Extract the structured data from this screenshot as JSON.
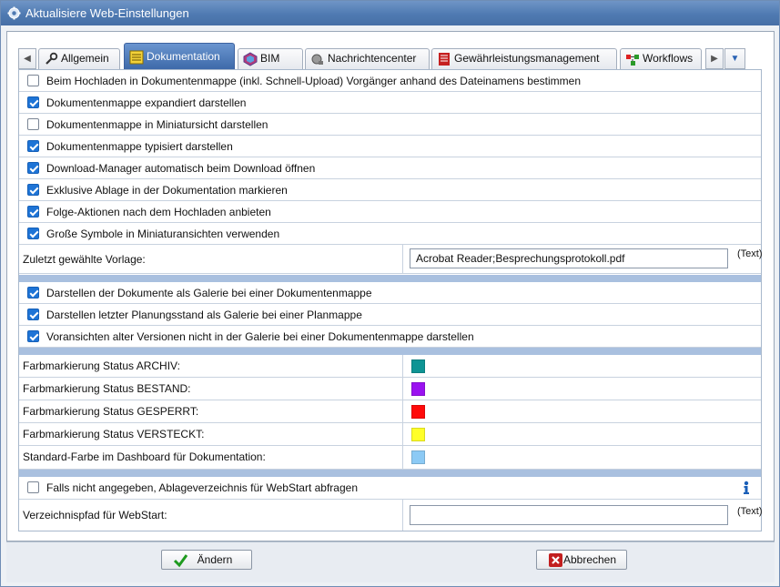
{
  "window": {
    "title": "Aktualisiere Web-Einstellungen"
  },
  "tabs": [
    {
      "label": "Allgemein",
      "icon": "wrench-icon"
    },
    {
      "label": "Dokumentation",
      "icon": "document-list-icon",
      "active": true
    },
    {
      "label": "BIM",
      "icon": "bim-icon"
    },
    {
      "label": "Nachrichtencenter",
      "icon": "satellite-icon"
    },
    {
      "label": "Gewährleistungsmanagement",
      "icon": "warranty-icon"
    },
    {
      "label": "Workflows",
      "icon": "workflow-icon"
    }
  ],
  "checkboxes_1": [
    {
      "label": "Beim Hochladen in Dokumentenmappe (inkl. Schnell-Upload) Vorgänger anhand des Dateinamens bestimmen",
      "checked": false
    },
    {
      "label": "Dokumentenmappe expandiert darstellen",
      "checked": true
    },
    {
      "label": "Dokumentenmappe in Miniatursicht darstellen",
      "checked": false
    },
    {
      "label": "Dokumentenmappe typisiert darstellen",
      "checked": true
    },
    {
      "label": "Download-Manager automatisch beim Download öffnen",
      "checked": true
    },
    {
      "label": "Exklusive Ablage in der Dokumentation markieren",
      "checked": true
    },
    {
      "label": "Folge-Aktionen nach dem Hochladen anbieten",
      "checked": true
    },
    {
      "label": "Große Symbole in Miniaturansichten verwenden",
      "checked": true
    }
  ],
  "vorlage": {
    "label": "Zuletzt gewählte Vorlage:",
    "value": "Acrobat Reader;Besprechungsprotokoll.pdf",
    "type_label": "(Text)"
  },
  "checkboxes_2": [
    {
      "label": "Darstellen der Dokumente als Galerie bei einer Dokumentenmappe",
      "checked": true
    },
    {
      "label": "Darstellen letzter Planungsstand als Galerie bei einer Planmappe",
      "checked": true
    },
    {
      "label": "Voransichten alter Versionen nicht in der Galerie bei einer Dokumentenmappe darstellen",
      "checked": true
    }
  ],
  "colors": [
    {
      "label": "Farbmarkierung Status ARCHIV:",
      "color": "#0e9494"
    },
    {
      "label": "Farbmarkierung Status BESTAND:",
      "color": "#9a12f0"
    },
    {
      "label": "Farbmarkierung Status GESPERRT:",
      "color": "#ff0a0a"
    },
    {
      "label": "Farbmarkierung Status VERSTECKT:",
      "color": "#ffff29"
    },
    {
      "label": "Standard-Farbe im Dashboard für Dokumentation:",
      "color": "#8ccaf5"
    }
  ],
  "webstart": {
    "checkbox_label": "Falls nicht angegeben, Ablageverzeichnis für WebStart abfragen",
    "checked": false,
    "path_label": "Verzeichnispfad für WebStart:",
    "path_value": "",
    "type_label": "(Text)"
  },
  "buttons": {
    "ok": "Ändern",
    "cancel": "Abbrechen"
  }
}
